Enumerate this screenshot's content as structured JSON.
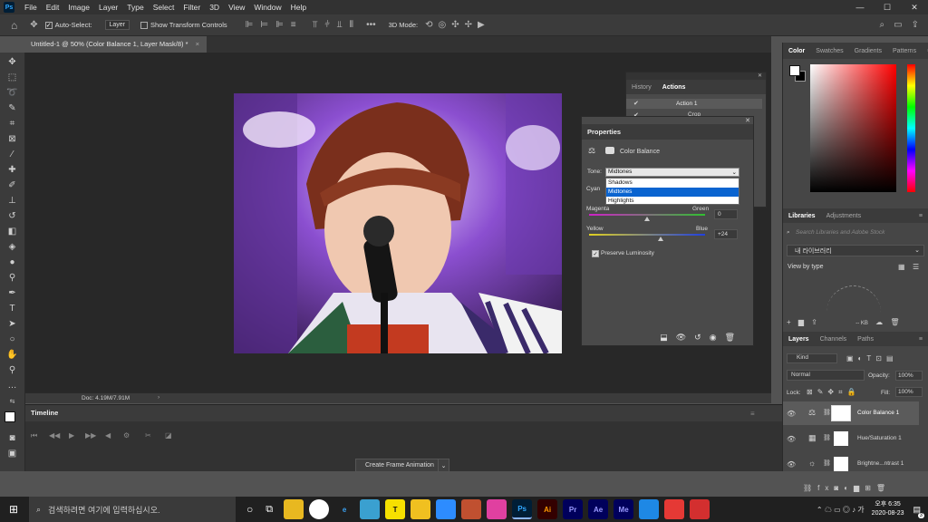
{
  "menubar": {
    "logo": "Ps",
    "items": [
      "File",
      "Edit",
      "Image",
      "Layer",
      "Type",
      "Select",
      "Filter",
      "3D",
      "View",
      "Window",
      "Help"
    ]
  },
  "options": {
    "auto_select_label": "Auto-Select:",
    "auto_select_value": "Layer",
    "transform_label": "Show Transform Controls",
    "mode_3d_label": "3D Mode:"
  },
  "document": {
    "tab_title": "Untitled-1 @ 50% (Color Balance 1, Layer Mask/8) *",
    "status": "Doc: 4.19M/7.91M"
  },
  "timeline": {
    "title": "Timeline",
    "create_label": "Create Frame Animation"
  },
  "history_actions": {
    "tabs": [
      "History",
      "Actions"
    ],
    "active_tab": "Actions",
    "action_label": "Action 1",
    "sub_label": "Crop"
  },
  "properties": {
    "title": "Properties",
    "adjustment": "Color Balance",
    "tone_label": "Tone:",
    "tone_value": "Midtones",
    "tone_options": [
      "Shadows",
      "Midtones",
      "Highlights"
    ],
    "sliders": [
      {
        "left": "Cyan",
        "right": "Red",
        "value": "0"
      },
      {
        "left": "Magenta",
        "right": "Green",
        "value": "0"
      },
      {
        "left": "Yellow",
        "right": "Blue",
        "value": "+24"
      }
    ],
    "preserve_label": "Preserve Luminosity"
  },
  "color_panel": {
    "tabs": [
      "Color",
      "Swatches",
      "Gradients",
      "Patterns"
    ],
    "active_tab": "Color"
  },
  "libraries": {
    "tabs": [
      "Libraries",
      "Adjustments"
    ],
    "search_placeholder": "Search Libraries and Adobe Stock",
    "library_name": "내 라이브러리",
    "view_by": "View by type",
    "kb": "-- KB"
  },
  "layers": {
    "tabs": [
      "Layers",
      "Channels",
      "Paths"
    ],
    "kind_label": "Kind",
    "blend_mode": "Normal",
    "opacity_label": "Opacity:",
    "opacity_value": "100%",
    "lock_label": "Lock:",
    "fill_label": "Fill:",
    "fill_value": "100%",
    "items": [
      {
        "name": "Color Balance 1"
      },
      {
        "name": "Hue/Saturation 1"
      },
      {
        "name": "Brightne...ntrast 1"
      }
    ]
  },
  "taskbar": {
    "search_placeholder": "검색하려면 여기에 입력하십시오.",
    "time": "오후 6:35",
    "date": "2020-08-23",
    "notif_count": "3"
  },
  "colors": {
    "bg": "#535353",
    "panel": "#464646",
    "accent": "#0a64d0"
  }
}
